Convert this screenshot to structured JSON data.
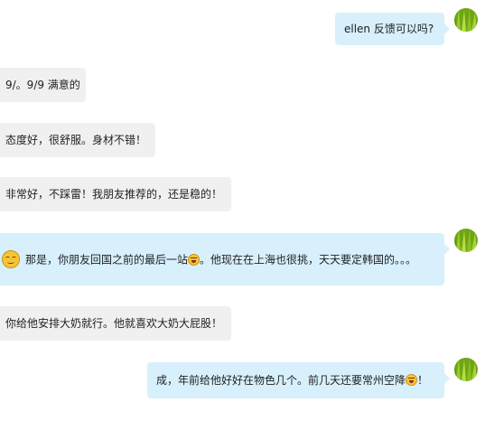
{
  "messages": [
    {
      "side": "out",
      "text": "ellen 反馈可以吗?"
    },
    {
      "side": "in",
      "text": "9/。9/9 满意的"
    },
    {
      "side": "in",
      "text": "态度好，很舒服。身材不错！"
    },
    {
      "side": "in",
      "text": "非常好，不踩雷！我朋友推荐的，还是稳的！"
    },
    {
      "side": "out",
      "emoji_lead": "relieved-face",
      "text_a": "那是，你朋友回国之前的最后一站",
      "emoji_mid": "tears-of-joy-face",
      "text_b": "。他现在在上海也很挑，天天要定韩国的。。。"
    },
    {
      "side": "in",
      "text": "你给他安排大奶就行。他就喜欢大奶大屁股！"
    },
    {
      "side": "out",
      "text_a": "成，年前给他好好在物色几个。前几天还要常州空降",
      "emoji_mid": "tears-of-joy-face",
      "text_b": "！"
    }
  ],
  "avatar_icon": "grass-avatar-icon",
  "colors": {
    "incoming_bubble": "#f0f0f0",
    "outgoing_bubble": "#d7f0fc",
    "background": "#ffffff"
  }
}
